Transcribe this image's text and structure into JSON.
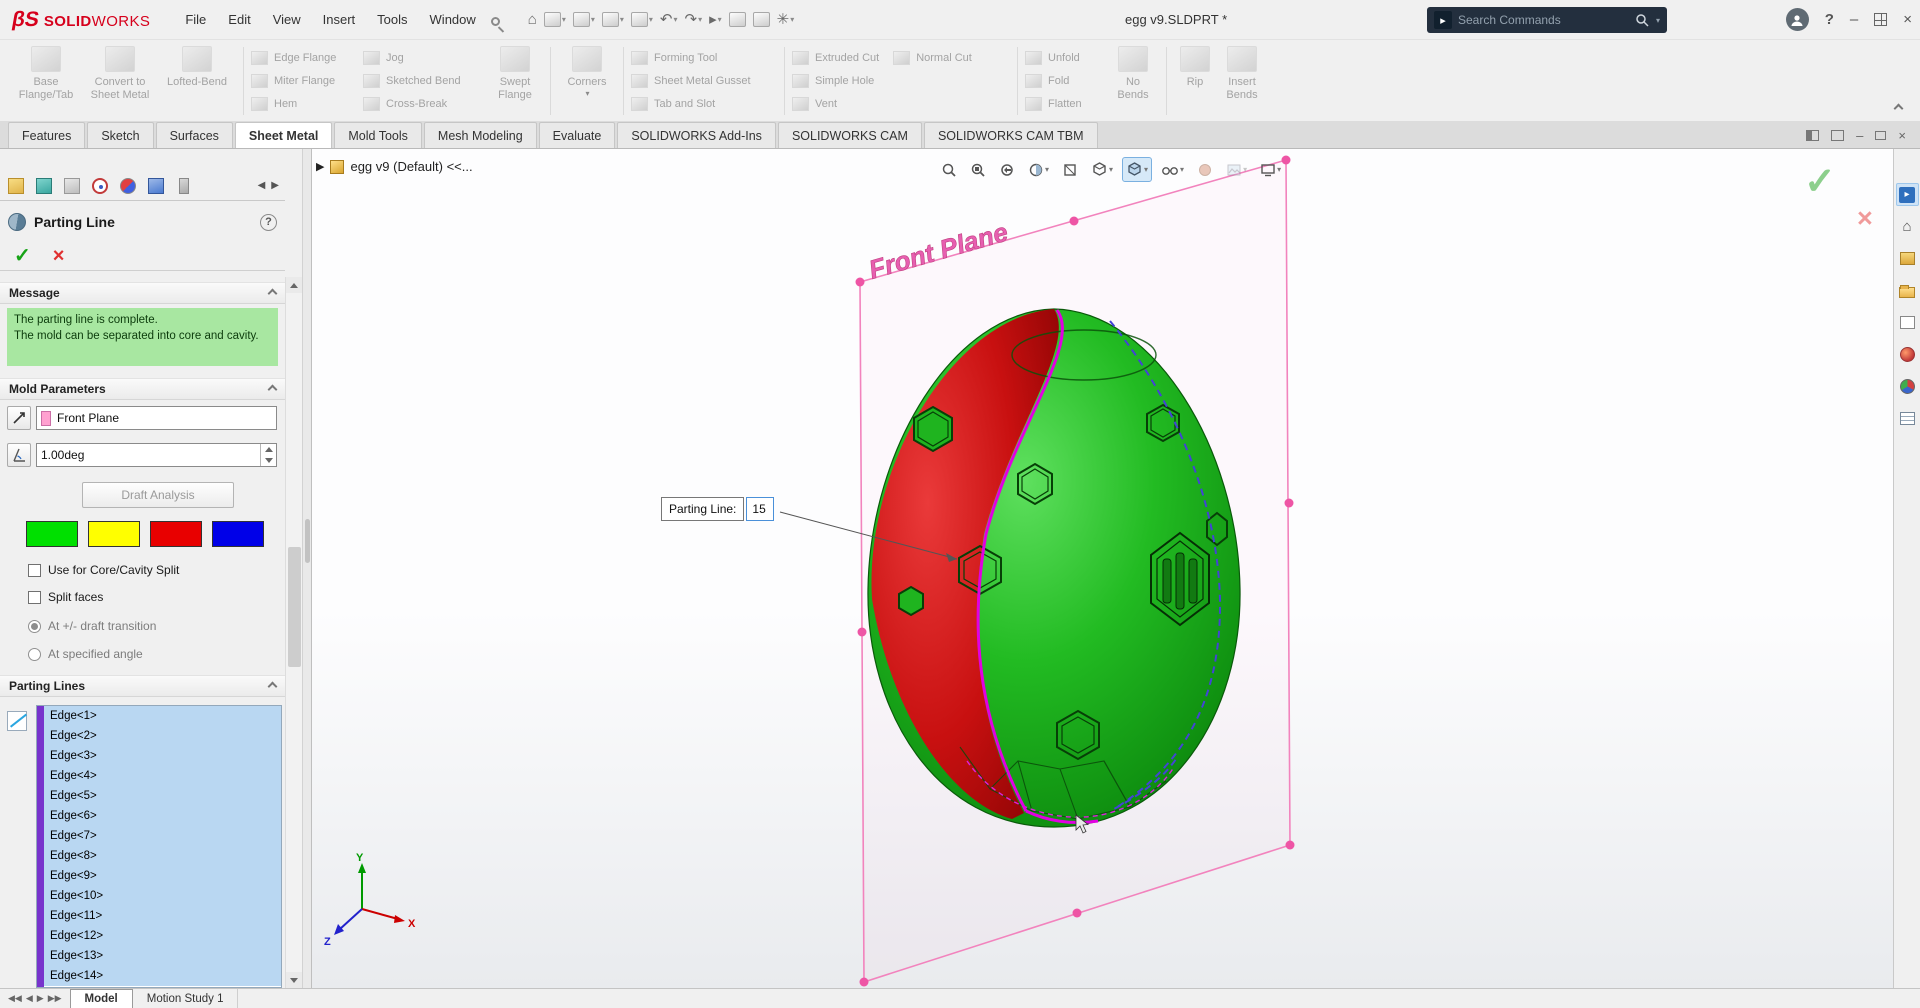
{
  "titlebar": {
    "brand_solid": "SOLID",
    "brand_works": "WORKS",
    "menus": [
      "File",
      "Edit",
      "View",
      "Insert",
      "Tools",
      "Window"
    ],
    "title": "egg v9.SLDPRT *",
    "search_placeholder": "Search Commands",
    "qat_icons": [
      "home",
      "new-document",
      "open-document",
      "save",
      "print",
      "undo",
      "redo",
      "select",
      "attachments",
      "sheet-properties",
      "options"
    ],
    "window_icons": [
      "user-profile",
      "help",
      "minimize",
      "window-layout",
      "close"
    ]
  },
  "command_manager": {
    "tabs": [
      "Features",
      "Sketch",
      "Surfaces",
      "Sheet Metal",
      "Mold Tools",
      "Mesh Modeling",
      "Evaluate",
      "SOLIDWORKS Add-Ins",
      "SOLIDWORKS CAM",
      "SOLIDWORKS CAM TBM"
    ],
    "active_tab": "Sheet Metal",
    "groups": {
      "g1": [
        "Base Flange/Tab",
        "Convert to Sheet Metal",
        "Lofted-Bend"
      ],
      "g2_col1": [
        "Edge Flange",
        "Miter Flange",
        "Hem"
      ],
      "g2_col2": [
        "Jog",
        "Sketched Bend",
        "Cross-Break"
      ],
      "g2_big": "Swept Flange",
      "g3_big": "Corners",
      "g4": [
        "Forming Tool",
        "Sheet Metal Gusset",
        "Tab and Slot"
      ],
      "g5_row": [
        "Extruded Cut",
        "Normal Cut"
      ],
      "g5_rest": [
        "Simple Hole",
        "Vent"
      ],
      "g6": [
        "Unfold",
        "Fold",
        "Flatten"
      ],
      "g6_big": "No Bends",
      "g7": [
        "Rip",
        "Insert Bends"
      ]
    }
  },
  "panel": {
    "tab_icons": [
      "featuremanager-tree",
      "propertymanager",
      "configurationmanager",
      "dimxpertmanager",
      "displaymanager",
      "cam-feature-tree",
      "cam-operation-tree"
    ],
    "title": "Parting Line",
    "message_header": "Message",
    "message_line1": "The parting line is complete.",
    "message_line2": "The mold can be separated into core and cavity.",
    "mold_parameters_header": "Mold Parameters",
    "direction_value": "Front Plane",
    "angle_value": "1.00deg",
    "draft_analysis_label": "Draft Analysis",
    "swatches": [
      "#00e000",
      "#ffff00",
      "#e80000",
      "#0000e8"
    ],
    "checkbox_core_cavity": "Use for Core/Cavity Split",
    "checkbox_split_faces": "Split faces",
    "radio_draft_transition": "At +/- draft transition",
    "radio_specified_angle": "At specified angle",
    "parting_lines_header": "Parting Lines",
    "edges": [
      "Edge<1>",
      "Edge<2>",
      "Edge<3>",
      "Edge<4>",
      "Edge<5>",
      "Edge<6>",
      "Edge<7>",
      "Edge<8>",
      "Edge<9>",
      "Edge<10>",
      "Edge<11>",
      "Edge<12>",
      "Edge<13>",
      "Edge<14>"
    ]
  },
  "viewport": {
    "breadcrumb": "egg v9 (Default) <<...",
    "plane_label": "Front Plane",
    "callout_label": "Parting Line:",
    "callout_value": "15",
    "triad": {
      "x": "X",
      "y": "Y",
      "z": "Z"
    },
    "toolbar_icons": [
      "zoom-to-fit",
      "zoom-to-area",
      "previous-view",
      "section-view",
      "view-selector",
      "view-orientation",
      "display-style",
      "hide-show-items",
      "edit-appearance",
      "apply-scene",
      "view-settings"
    ],
    "colors": {
      "egg_green": "#1eb41e",
      "egg_red": "#c81010",
      "plane_pink": "#f07ab8",
      "parting_line_magenta": "#e100e1",
      "transition_blue": "#4343d6",
      "selection_blue": "#b9d7f2",
      "message_green": "#a8e7a1"
    }
  },
  "taskpane": {
    "icons": [
      "solidworks-resources",
      "home",
      "design-library",
      "file-explorer",
      "view-palette",
      "appearances",
      "scenes",
      "custom-properties"
    ]
  },
  "statusbar": {
    "tabs": [
      "Model",
      "Motion Study 1"
    ]
  }
}
